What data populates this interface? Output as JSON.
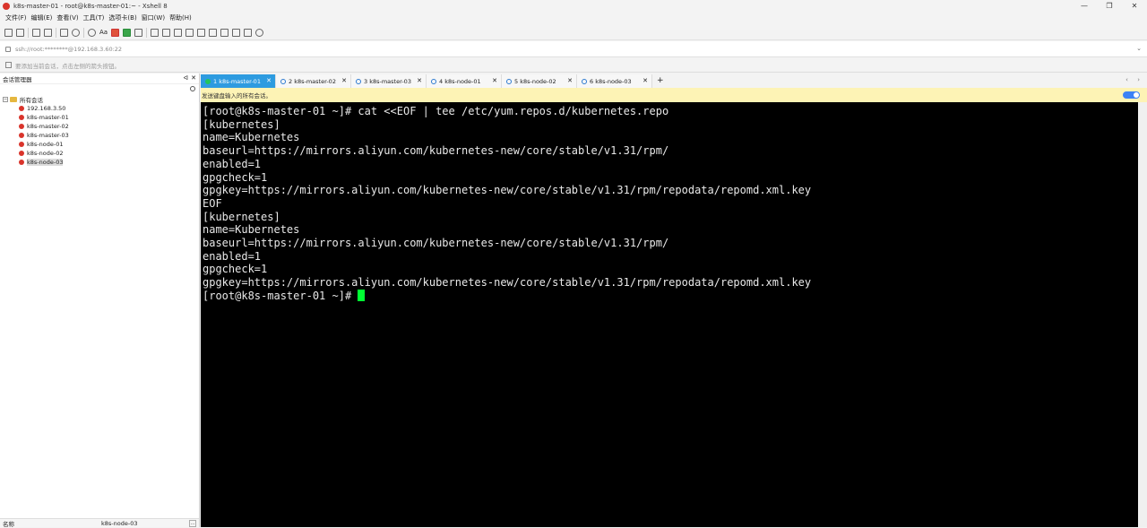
{
  "window": {
    "title": "k8s-master-01 - root@k8s-master-01:~ - Xshell 8",
    "controls": [
      "—",
      "❐",
      "✕"
    ]
  },
  "menu": [
    "文件(F)",
    "编辑(E)",
    "查看(V)",
    "工具(T)",
    "选项卡(B)",
    "窗口(W)",
    "帮助(H)"
  ],
  "toolbar": {
    "font_label": "Aa"
  },
  "address": {
    "value": "ssh://root:********@192.168.3.60:22"
  },
  "hint": {
    "text": "要添加当前会话，点击左侧的箭头按钮。"
  },
  "sidebar": {
    "title": "会话管理器",
    "pin": "ᐊ",
    "root": "所有会话",
    "sessions": [
      "192.168.3.50",
      "k8s-master-01",
      "k8s-master-02",
      "k8s-master-03",
      "k8s-node-01",
      "k8s-node-02",
      "k8s-node-03"
    ],
    "footer": {
      "label": "名称",
      "value": "k8s-node-03",
      "button": "..."
    }
  },
  "tabs": [
    {
      "label": "1 k8s-master-01"
    },
    {
      "label": "2 k8s-master-02"
    },
    {
      "label": "3 k8s-master-03"
    },
    {
      "label": "4 k8s-node-01"
    },
    {
      "label": "5 k8s-node-02"
    },
    {
      "label": "6 k8s-node-03"
    }
  ],
  "tab_add": "+",
  "tab_nav": "‹ ›",
  "sendbar": {
    "text": "发送键盘输入的所有会话。"
  },
  "terminal": {
    "lines": [
      "[root@k8s-master-01 ~]# cat <<EOF | tee /etc/yum.repos.d/kubernetes.repo",
      "[kubernetes]",
      "name=Kubernetes",
      "baseurl=https://mirrors.aliyun.com/kubernetes-new/core/stable/v1.31/rpm/",
      "enabled=1",
      "gpgcheck=1",
      "gpgkey=https://mirrors.aliyun.com/kubernetes-new/core/stable/v1.31/rpm/repodata/repomd.xml.key",
      "EOF",
      "[kubernetes]",
      "name=Kubernetes",
      "baseurl=https://mirrors.aliyun.com/kubernetes-new/core/stable/v1.31/rpm/",
      "enabled=1",
      "gpgcheck=1",
      "gpgkey=https://mirrors.aliyun.com/kubernetes-new/core/stable/v1.31/rpm/repodata/repomd.xml.key"
    ],
    "prompt": "[root@k8s-master-01 ~]# "
  },
  "colors": {
    "accent": "#2d9be0",
    "cursor": "#00ff33",
    "sendbar": "#fdf3b5"
  }
}
